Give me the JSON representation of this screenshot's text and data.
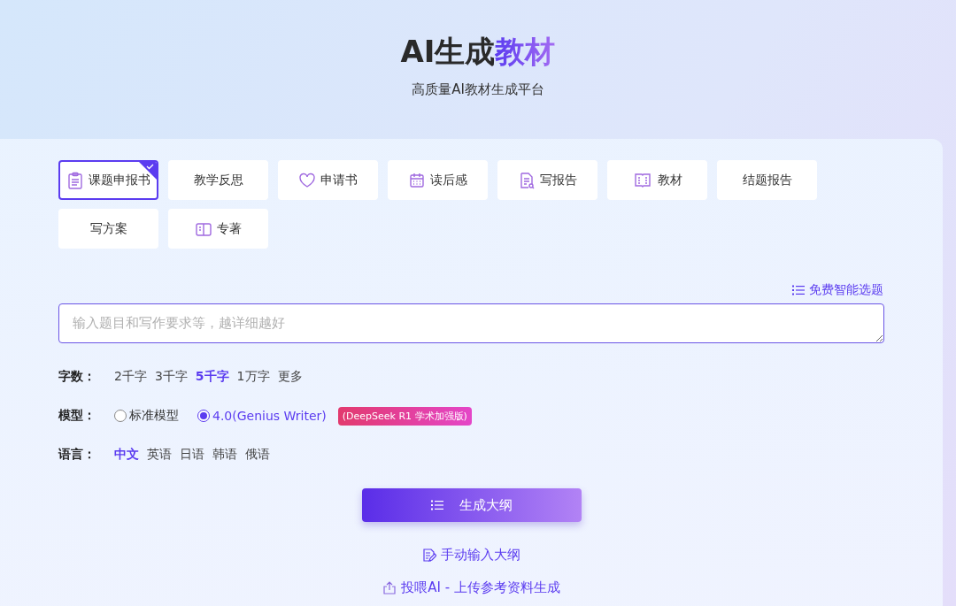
{
  "header": {
    "title": "AI生成",
    "title_accent": "教材",
    "subtitle": "高质量AI教材生成平台"
  },
  "types": [
    {
      "label": "课题申报书",
      "selected": true
    },
    {
      "label": "教学反思",
      "selected": false
    },
    {
      "label": "申请书",
      "selected": false
    },
    {
      "label": "读后感",
      "selected": false
    },
    {
      "label": "写报告",
      "selected": false
    },
    {
      "label": "教材",
      "selected": false
    },
    {
      "label": "结题报告",
      "selected": false
    },
    {
      "label": "写方案",
      "selected": false
    },
    {
      "label": "专著",
      "selected": false
    }
  ],
  "topic_link": "免费智能选题",
  "prompt": {
    "placeholder": "输入题目和写作要求等，越详细越好"
  },
  "word_count": {
    "label": "字数：",
    "options": [
      {
        "label": "2千字",
        "selected": false
      },
      {
        "label": "3千字",
        "selected": false
      },
      {
        "label": "5千字",
        "selected": true
      },
      {
        "label": "1万字",
        "selected": false
      },
      {
        "label": "更多",
        "selected": false
      }
    ]
  },
  "model": {
    "label": "模型：",
    "options": [
      {
        "label": "标准模型",
        "selected": false
      },
      {
        "label": "4.0(Genius Writer)",
        "selected": true,
        "badge": "(DeepSeek R1 学术加强版)"
      }
    ]
  },
  "language": {
    "label": "语言：",
    "options": [
      {
        "label": "中文",
        "selected": true
      },
      {
        "label": "英语",
        "selected": false
      },
      {
        "label": "日语",
        "selected": false
      },
      {
        "label": "韩语",
        "selected": false
      },
      {
        "label": "俄语",
        "selected": false
      }
    ]
  },
  "generate_button": "生成大纲",
  "manual_link": "手动输入大纲",
  "upload_link": "投喂AI - 上传参考资料生成"
}
